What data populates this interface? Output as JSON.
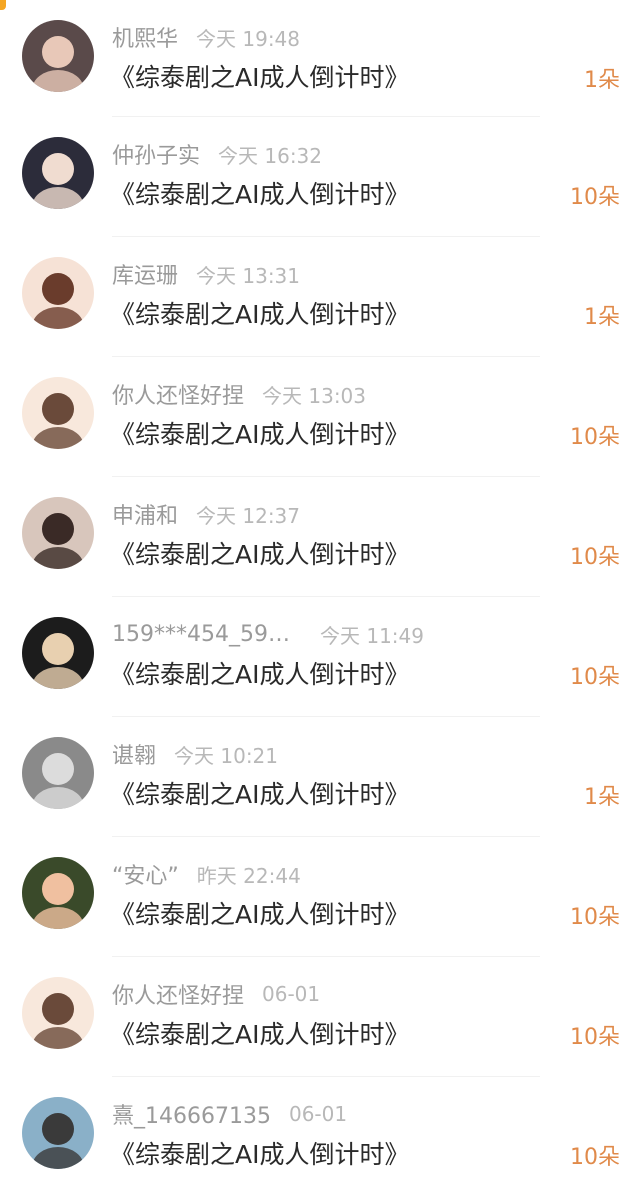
{
  "gifts": [
    {
      "name": "机熙华",
      "time": "今天 19:48",
      "title": "《综泰剧之AI成人倒计时》",
      "count": "1朵",
      "avatar": {
        "icon": "avatar-girl-dark",
        "bg": "#5a4a4a",
        "fg": "#e8c8b8"
      }
    },
    {
      "name": "仲孙子实",
      "time": "今天 16:32",
      "title": "《综泰剧之AI成人倒计时》",
      "count": "10朵",
      "avatar": {
        "icon": "avatar-anime-boy",
        "bg": "#2c2c3a",
        "fg": "#f0dcd0"
      }
    },
    {
      "name": "库运珊",
      "time": "今天 13:31",
      "title": "《综泰剧之AI成人倒计时》",
      "count": "1朵",
      "avatar": {
        "icon": "avatar-cartoon-kid",
        "bg": "#f6e2d6",
        "fg": "#6a3c2c"
      }
    },
    {
      "name": "你人还怪好捏",
      "time": "今天 13:03",
      "title": "《综泰剧之AI成人倒计时》",
      "count": "10朵",
      "avatar": {
        "icon": "avatar-anime-eyes",
        "bg": "#f8e8dc",
        "fg": "#6a4a3a"
      }
    },
    {
      "name": "申浦和",
      "time": "今天 12:37",
      "title": "《综泰剧之AI成人倒计时》",
      "count": "10朵",
      "avatar": {
        "icon": "avatar-girl-photo",
        "bg": "#d8c6bc",
        "fg": "#3a2a26"
      }
    },
    {
      "name": "159***454_591...",
      "time": "今天 11:49",
      "title": "《综泰剧之AI成人倒计时》",
      "count": "10朵",
      "avatar": {
        "icon": "avatar-girl-dress",
        "bg": "#1c1c1c",
        "fg": "#e8d0b0"
      }
    },
    {
      "name": "谌翱",
      "time": "今天 10:21",
      "title": "《综泰剧之AI成人倒计时》",
      "count": "1朵",
      "avatar": {
        "icon": "avatar-grayscale-girl",
        "bg": "#8a8a8a",
        "fg": "#dcdcdc"
      }
    },
    {
      "name": "“安心”",
      "time": "昨天 22:44",
      "title": "《综泰剧之AI成人倒计时》",
      "count": "10朵",
      "avatar": {
        "icon": "avatar-flowers",
        "bg": "#3a4a2a",
        "fg": "#f0c0a0"
      }
    },
    {
      "name": "你人还怪好捏",
      "time": "06-01",
      "title": "《综泰剧之AI成人倒计时》",
      "count": "10朵",
      "avatar": {
        "icon": "avatar-anime-eyes",
        "bg": "#f8e8dc",
        "fg": "#6a4a3a"
      }
    },
    {
      "name": "熹_146667135",
      "time": "06-01",
      "title": "《综泰剧之AI成人倒计时》",
      "count": "10朵",
      "avatar": {
        "icon": "avatar-mountain",
        "bg": "#8ab0c8",
        "fg": "#3a3a3a"
      }
    }
  ],
  "colors": {
    "count": "#e08a4a",
    "name": "#9a9a9a",
    "time": "#b8b8b8",
    "title": "#2a2a2a"
  }
}
